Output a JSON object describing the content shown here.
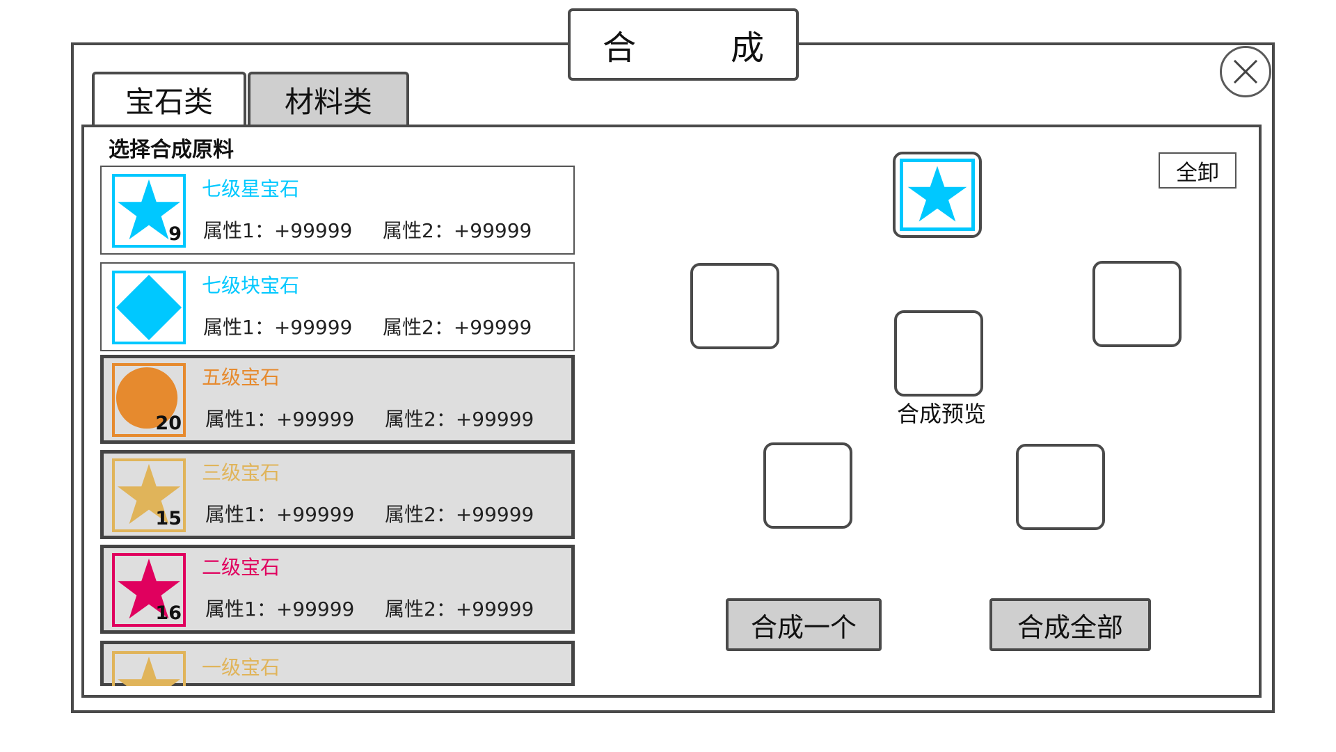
{
  "window": {
    "title": "合　成"
  },
  "tabs": [
    {
      "label": "宝石类",
      "selected": true
    },
    {
      "label": "材料类",
      "selected": false
    }
  ],
  "list_title": "选择合成原料",
  "gems": [
    {
      "name": "七级星宝石",
      "color": "#00c8ff",
      "icon": "star-icon",
      "count": "9",
      "attr1": "属性1：+99999",
      "attr2": "属性2：+99999",
      "dimmed": false
    },
    {
      "name": "七级块宝石",
      "color": "#00c8ff",
      "icon": "diamond-icon",
      "count": "",
      "attr1": "属性1：+99999",
      "attr2": "属性2：+99999",
      "dimmed": false
    },
    {
      "name": "五级宝石",
      "color": "#e68a2e",
      "icon": "circle-icon",
      "count": "20",
      "attr1": "属性1：+99999",
      "attr2": "属性2：+99999",
      "dimmed": true
    },
    {
      "name": "三级宝石",
      "color": "#e0b45a",
      "icon": "star-icon",
      "count": "15",
      "attr1": "属性1：+99999",
      "attr2": "属性2：+99999",
      "dimmed": true
    },
    {
      "name": "二级宝石",
      "color": "#e0005e",
      "icon": "star-icon",
      "count": "16",
      "attr1": "属性1：+99999",
      "attr2": "属性2：+99999",
      "dimmed": true
    },
    {
      "name": "一级宝石",
      "color": "#e0b45a",
      "icon": "star-icon",
      "count": "",
      "attr1": "",
      "attr2": "",
      "dimmed": true
    }
  ],
  "synthesis": {
    "top_slot": {
      "icon": "star-icon",
      "color": "#00c8ff"
    },
    "preview_label": "合成预览",
    "unload_all_label": "全卸",
    "craft_one_label": "合成一个",
    "craft_all_label": "合成全部"
  },
  "colors": {
    "border": "#4a4a4a",
    "tab_inactive": "#cfcfcf",
    "row_dim": "#dedede",
    "accent_cyan": "#00c8ff"
  }
}
